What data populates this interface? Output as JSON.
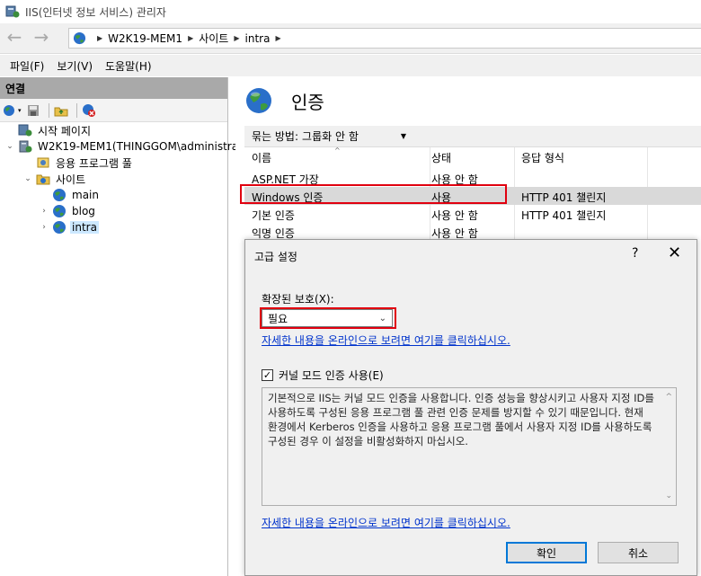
{
  "window": {
    "title": "IIS(인터넷 정보 서비스) 관리자"
  },
  "address": {
    "crumbs": [
      "W2K19-MEM1",
      "사이트",
      "intra"
    ]
  },
  "menu": {
    "items": [
      "파일(F)",
      "보기(V)",
      "도움말(H)"
    ]
  },
  "connections": {
    "header": "연결",
    "tree": [
      {
        "label": "시작 페이지"
      },
      {
        "label": "W2K19-MEM1(THINGGOM\\administrator)"
      },
      {
        "label": "응용 프로그램 풀"
      },
      {
        "label": "사이트"
      },
      {
        "label": "main"
      },
      {
        "label": "blog"
      },
      {
        "label": "intra",
        "selected": true
      }
    ]
  },
  "auth": {
    "title": "인증",
    "group_label": "묶는 방법:",
    "group_value": "그룹화 안 함",
    "columns": [
      "이름",
      "상태",
      "응답 형식"
    ],
    "rows": [
      {
        "name": "ASP.NET 가장",
        "status": "사용 안 함",
        "response": ""
      },
      {
        "name": "Windows 인증",
        "status": "사용",
        "response": "HTTP 401 챌린지",
        "selected": true
      },
      {
        "name": "기본 인증",
        "status": "사용 안 함",
        "response": "HTTP 401 챌린지"
      },
      {
        "name": "익명 인증",
        "status": "사용 안 함",
        "response": ""
      }
    ]
  },
  "dialog": {
    "title": "고급 설정",
    "help": "?",
    "close": "✕",
    "extended_protection_label": "확장된 보호(X):",
    "extended_protection_value": "필요",
    "link_text": "자세한 내용을 온라인으로 보려면 여기를 클릭하십시오.",
    "kernel_mode_label": "커널 모드 인증 사용(E)",
    "kernel_mode_checked": true,
    "description": "기본적으로 IIS는 커널 모드 인증을 사용합니다. 인증 성능을 향상시키고 사용자 지정 ID를 사용하도록 구성된 응용 프로그램 풀 관련 인증 문제를 방지할 수 있기 때문입니다. 현재 환경에서 Kerberos 인증을 사용하고 응용 프로그램 풀에서 사용자 지정 ID를 사용하도록 구성된 경우 이 설정을 비활성화하지 마십시오.",
    "link_text_2": "자세한 내용을 온라인으로 보려면 여기를 클릭하십시오.",
    "ok_label": "확인",
    "cancel_label": "취소"
  },
  "colors": {
    "highlight": "#e0000f",
    "link": "#0033cc",
    "selection": "#cce8ff"
  }
}
